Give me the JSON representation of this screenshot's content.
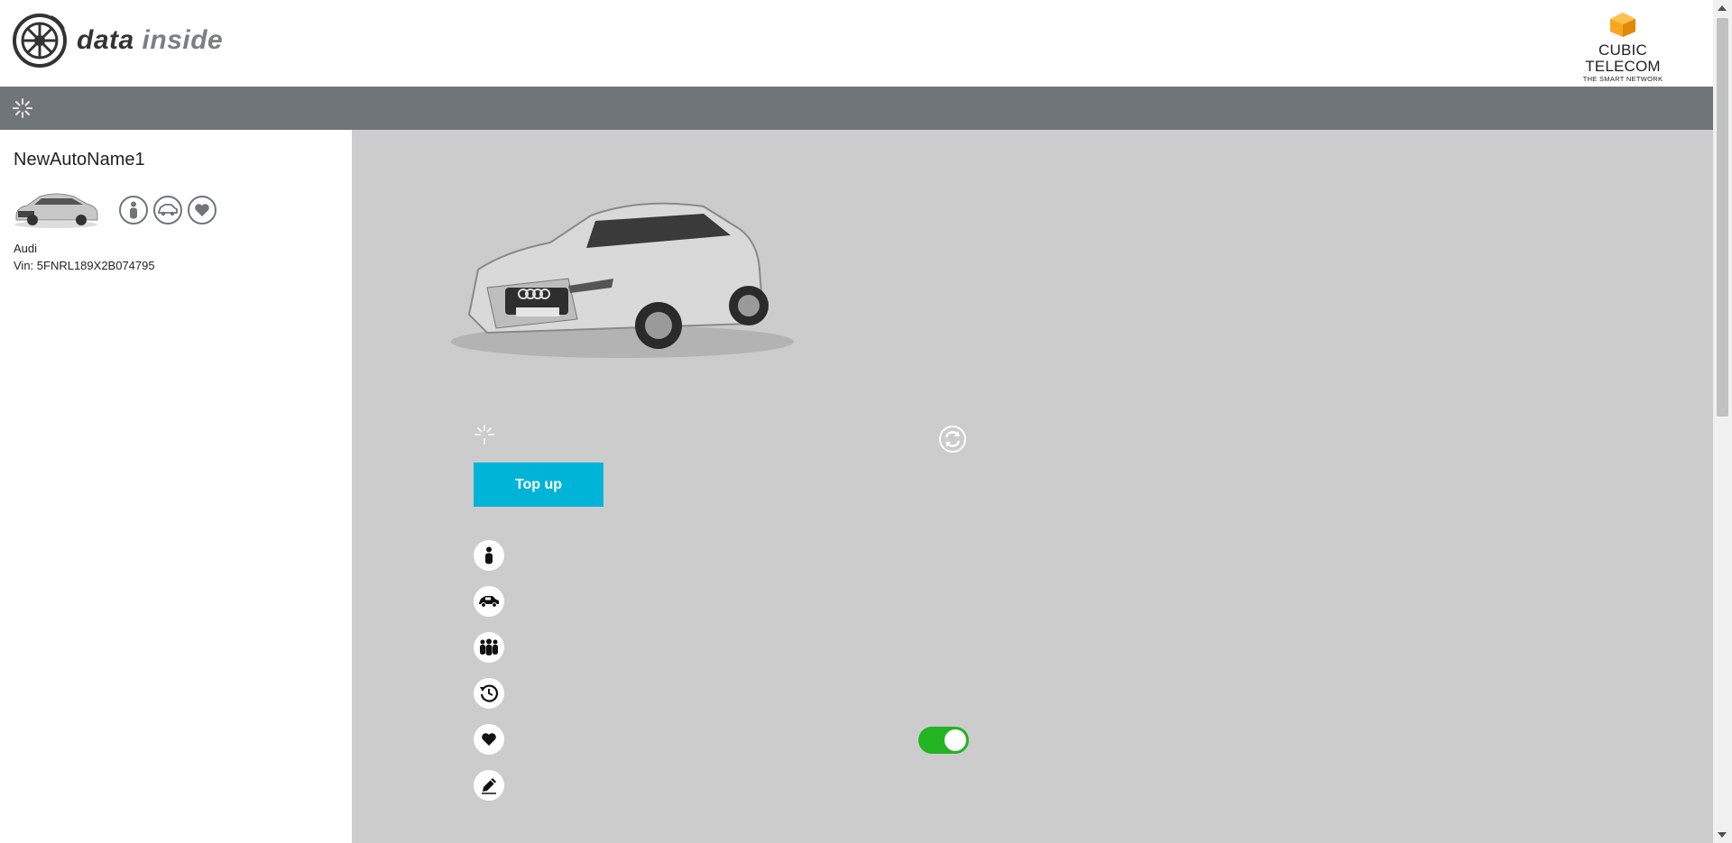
{
  "header": {
    "logo_text_bold": "data",
    "logo_text_light": "inside",
    "partner_name": "CUBIC TELECOM",
    "partner_tagline": "THE SMART NETWORK"
  },
  "vehicle": {
    "name": "NewAutoName1",
    "make": "Audi",
    "vin": "Vin: 5FNRL189X2B074795"
  },
  "main": {
    "topup_label": "Top up",
    "favourite_toggle_on": true
  },
  "colors": {
    "toolbar": "#6f7579",
    "main_bg": "#cccccc",
    "accent_button": "#00b4d8",
    "toggle_on": "#22b422"
  },
  "icons": [
    "loading-spinner-icon",
    "person-icon",
    "car-icon",
    "heart-icon",
    "refresh-icon",
    "group-icon",
    "history-icon",
    "pencil-icon"
  ]
}
